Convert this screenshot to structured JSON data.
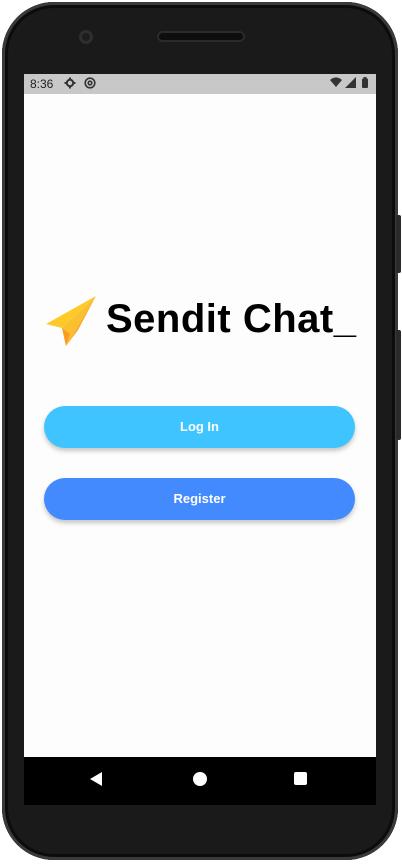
{
  "status_bar": {
    "time": "8:36",
    "icons": [
      "gear-icon",
      "at-sign-icon",
      "wifi-icon",
      "signal-icon",
      "battery-icon"
    ]
  },
  "brand": {
    "logo_icon": "paper-plane-icon",
    "title": "Sendit Chat_"
  },
  "buttons": {
    "login_label": "Log In",
    "register_label": "Register"
  },
  "colors": {
    "login_button": "#40c4ff",
    "register_button": "#448aff",
    "plane_main": "#ffca28",
    "plane_shade": "#f9a825",
    "status_bar": "#c8c8c8"
  },
  "nav_bar": {
    "icons": [
      "back-icon",
      "home-icon",
      "recents-icon"
    ]
  }
}
